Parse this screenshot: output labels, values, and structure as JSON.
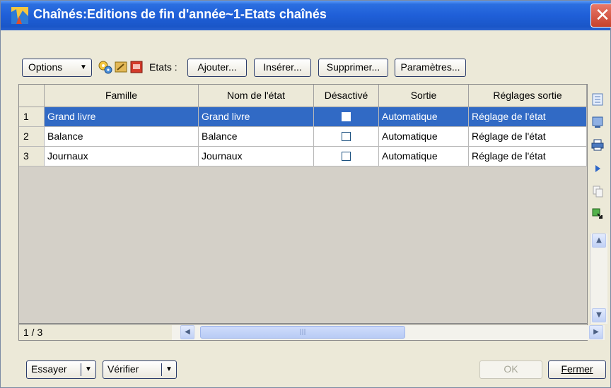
{
  "window": {
    "title": "Chaînés:Editions de fin d'année~1-Etats chaînés",
    "close_glyph": "✕"
  },
  "toolbar": {
    "options_label": "Options",
    "etats_label": "Etats :",
    "ajouter_label": "Ajouter...",
    "inserer_label": "Insérer...",
    "supprimer_label": "Supprimer...",
    "parametres_label": "Paramètres...",
    "icons": [
      "settings-gears-icon",
      "folder-icon",
      "report-red-icon"
    ]
  },
  "grid": {
    "columns": [
      "Famille",
      "Nom de l'état",
      "Désactivé",
      "Sortie",
      "Réglages sortie"
    ],
    "rows": [
      {
        "num": "1",
        "famille": "Grand livre",
        "nom": "Grand livre",
        "desactive": false,
        "sortie": "Automatique",
        "reglages": "Réglage de l'état",
        "selected": true
      },
      {
        "num": "2",
        "famille": "Balance",
        "nom": "Balance",
        "desactive": false,
        "sortie": "Automatique",
        "reglages": "Réglage de l'état",
        "selected": false
      },
      {
        "num": "3",
        "famille": "Journaux",
        "nom": "Journaux",
        "desactive": false,
        "sortie": "Automatique",
        "reglages": "Réglage de l'état",
        "selected": false
      }
    ]
  },
  "side_icons": [
    "column-settings-icon",
    "preview-icon",
    "print-icon",
    "play-icon",
    "copy-icon",
    "export-icon"
  ],
  "status": {
    "record_counter": "1 / 3"
  },
  "footer": {
    "essayer_label": "Essayer",
    "verifier_label": "Vérifier",
    "ok_label": "OK",
    "fermer_label": "Fermer"
  },
  "colors": {
    "titlebar": "#1f5fd8",
    "selection": "#316ac5",
    "window_bg": "#ece9d8"
  }
}
